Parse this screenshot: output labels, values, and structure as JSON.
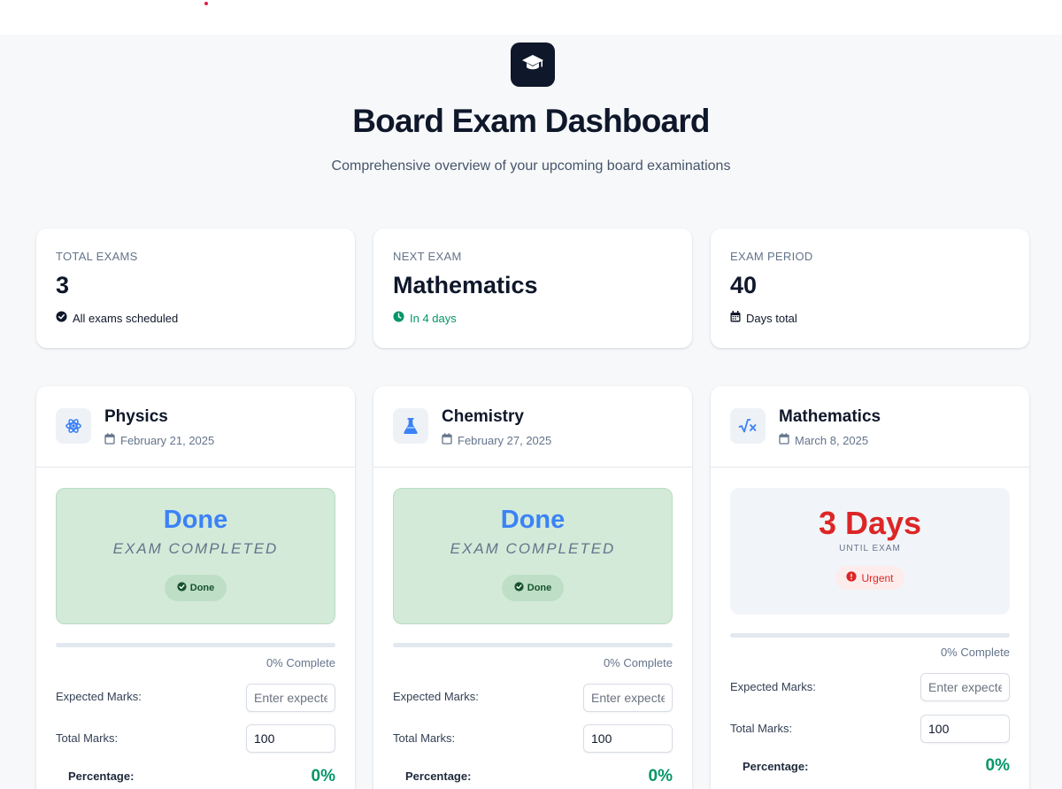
{
  "header": {
    "title": "Board Exam Dashboard",
    "subtitle": "Comprehensive overview of your upcoming board examinations",
    "logo_icon": "graduation-cap-icon"
  },
  "stats": [
    {
      "label": "Total Exams",
      "value": "3",
      "note": "All exams scheduled",
      "icon": "check-circle-icon"
    },
    {
      "label": "Next Exam",
      "value": "Mathematics",
      "note": "In 4 days",
      "icon": "clock-icon",
      "note_color": "#059669"
    },
    {
      "label": "Exam Period",
      "value": "40",
      "note": "Days total",
      "icon": "calendar-icon"
    }
  ],
  "exams": [
    {
      "subject": "Physics",
      "date": "February 21, 2025",
      "icon": "atom-icon",
      "status_title": "Done",
      "status_subtitle": "EXAM COMPLETED",
      "badge": "Done",
      "progress_percent": 0,
      "progress_text": "0% Complete",
      "expected_label": "Expected Marks:",
      "expected_placeholder": "Enter expected marks",
      "total_label": "Total Marks:",
      "total_value": "100",
      "percentage_label": "Percentage:",
      "percentage_value": "0%"
    },
    {
      "subject": "Chemistry",
      "date": "February 27, 2025",
      "icon": "flask-icon",
      "status_title": "Done",
      "status_subtitle": "EXAM COMPLETED",
      "badge": "Done",
      "progress_percent": 0,
      "progress_text": "0% Complete",
      "expected_label": "Expected Marks:",
      "expected_placeholder": "Enter expected marks",
      "total_label": "Total Marks:",
      "total_value": "100",
      "percentage_label": "Percentage:",
      "percentage_value": "0%"
    },
    {
      "subject": "Mathematics",
      "date": "March 8, 2025",
      "icon": "square-root-icon",
      "status_title": "3 Days",
      "status_subtitle": "until exam",
      "badge": "Urgent",
      "progress_percent": 0,
      "progress_text": "0% Complete",
      "expected_label": "Expected Marks:",
      "expected_placeholder": "Enter expected marks",
      "total_label": "Total Marks:",
      "total_value": "100",
      "percentage_label": "Percentage:",
      "percentage_value": "0%"
    }
  ],
  "colors": {
    "accent": "#3b82f6",
    "success": "#059669",
    "urgent": "#dc2626",
    "dark": "#0f172a"
  }
}
